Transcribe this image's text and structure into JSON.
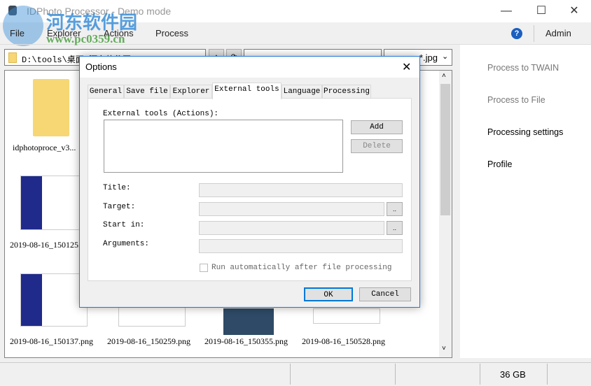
{
  "window": {
    "title": "IDPhoto Processor - Demo mode",
    "minimize": "—",
    "maximize": "☐",
    "close": "✕"
  },
  "menu": {
    "items": [
      "File",
      "Explorer",
      "Actions",
      "Process"
    ],
    "help": "?",
    "user": "Admin"
  },
  "pathbar": {
    "path": "D:\\tools\\桌面\\河东软件园",
    "up": "▲",
    "refresh": "⟳",
    "filter": "*.jpg"
  },
  "files": [
    {
      "name": "idphotoproce_v3..."
    },
    {
      "name": "2019-08-16_150125..."
    },
    {
      "name": "2019-08-16_150137.png"
    },
    {
      "name": "2019-08-16_150259.png"
    },
    {
      "name": "2019-08-16_150355.png"
    },
    {
      "name": "2019-08-16_150528.png"
    }
  ],
  "right_panel": {
    "items": [
      {
        "label": "Process to TWAIN",
        "enabled": false
      },
      {
        "label": "Process to File",
        "enabled": false
      },
      {
        "label": "Processing settings",
        "enabled": true
      },
      {
        "label": "Profile",
        "enabled": true
      }
    ]
  },
  "status": {
    "disk": "36 GB"
  },
  "dialog": {
    "title": "Options",
    "close": "✕",
    "tabs": [
      "General",
      "Save file",
      "Explorer",
      "External tools",
      "Language",
      "Processing"
    ],
    "active_tab": "External tools",
    "list_label": "External tools (Actions):",
    "add": "Add",
    "delete": "Delete",
    "fields": {
      "title": "Title:",
      "target": "Target:",
      "start_in": "Start in:",
      "arguments": "Arguments:"
    },
    "browse": "..",
    "checkbox": "Run automatically after file processing",
    "checkbox_checked": false,
    "ok": "OK",
    "cancel": "Cancel"
  },
  "watermark": {
    "name": "河东软件园",
    "url": "www.pc0359.cn"
  }
}
